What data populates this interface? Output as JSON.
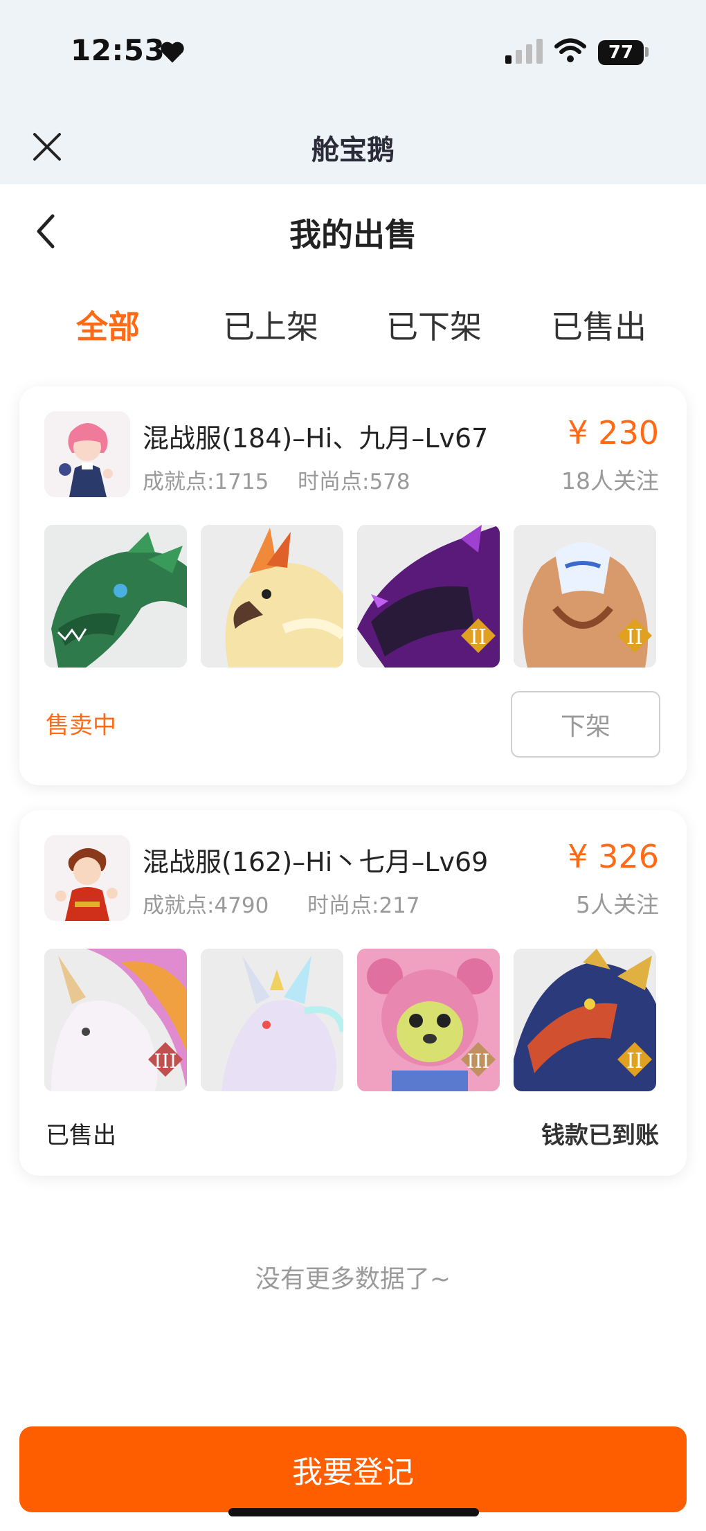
{
  "status_bar": {
    "time": "12:53",
    "battery": "77"
  },
  "app": {
    "title": "舱宝鹅",
    "close_icon": "close-icon"
  },
  "page": {
    "title": "我的出售",
    "back_icon": "chevron-left-icon"
  },
  "tabs": [
    {
      "label": "全部",
      "active": true
    },
    {
      "label": "已上架",
      "active": false
    },
    {
      "label": "已下架",
      "active": false
    },
    {
      "label": "已售出",
      "active": false
    }
  ],
  "listings": [
    {
      "title": "混战服(184)–Hi、九月–Lv67",
      "achievement": "成就点:1715",
      "fashion": "时尚点:578",
      "price": "¥ 230",
      "followers": "18人关注",
      "status": "售卖中",
      "action": "下架",
      "thumbnails": [
        {
          "name": "green-dragon-mount",
          "badge": ""
        },
        {
          "name": "golden-bird-mount",
          "badge": ""
        },
        {
          "name": "purple-dragon-mount",
          "badge": "II"
        },
        {
          "name": "masked-wolf-mount",
          "badge": "II"
        }
      ]
    },
    {
      "title": "混战服(162)–Hi丶七月–Lv69",
      "achievement": "成就点:4790",
      "fashion": "时尚点:217",
      "price": "¥ 326",
      "followers": "5人关注",
      "status": "已售出",
      "payment_status": "钱款已到账",
      "thumbnails": [
        {
          "name": "unicorn-mount",
          "badge": "III"
        },
        {
          "name": "white-fox-mount",
          "badge": ""
        },
        {
          "name": "pink-bear-pet",
          "badge": "III"
        },
        {
          "name": "armored-dragon-mount",
          "badge": "II"
        }
      ]
    }
  ],
  "footer": {
    "no_more": "没有更多数据了~",
    "register_button": "我要登记"
  },
  "colors": {
    "accent": "#ff6a16",
    "button": "#ff5e00",
    "header_bg": "#eef3f7"
  }
}
